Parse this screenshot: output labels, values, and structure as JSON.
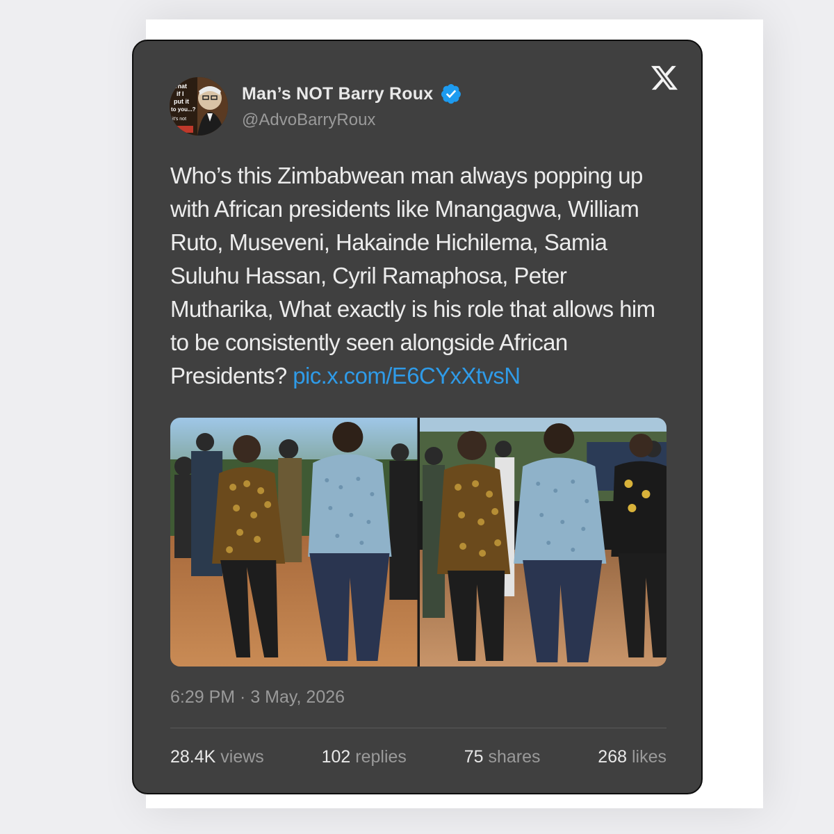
{
  "tweet": {
    "display_name": "Man’s NOT Barry Roux",
    "handle": "@AdvoBarryRoux",
    "text": "Who’s this Zimbabwean man always popping up with African presidents like Mnangagwa, William Ruto, Museveni, Hakainde Hichilema, Samia Suluhu Hassan, Cyril Ramaphosa, Peter Mutharika, What exactly is his role that allows him to be consistently seen alongside African Presidents?",
    "link": "pic.x.com/E6CYxXtvsN",
    "timestamp": "6:29 PM · 3 May, 2026",
    "avatar": {
      "line1": "What",
      "line2": "if I",
      "line3": "put it",
      "line4": "to you...?",
      "line5": "it's not"
    }
  },
  "stats": {
    "views_count": "28.4K",
    "views_label": "views",
    "replies_count": "102",
    "replies_label": "replies",
    "shares_count": "75",
    "shares_label": "shares",
    "likes_count": "268",
    "likes_label": "likes"
  },
  "icons": {
    "brand": "x-logo-icon",
    "verified": "verified-badge-icon"
  },
  "colors": {
    "card_bg": "#404040",
    "link": "#2f9be8",
    "verified": "#1d9bf0",
    "muted_text": "#9a9a9a"
  }
}
